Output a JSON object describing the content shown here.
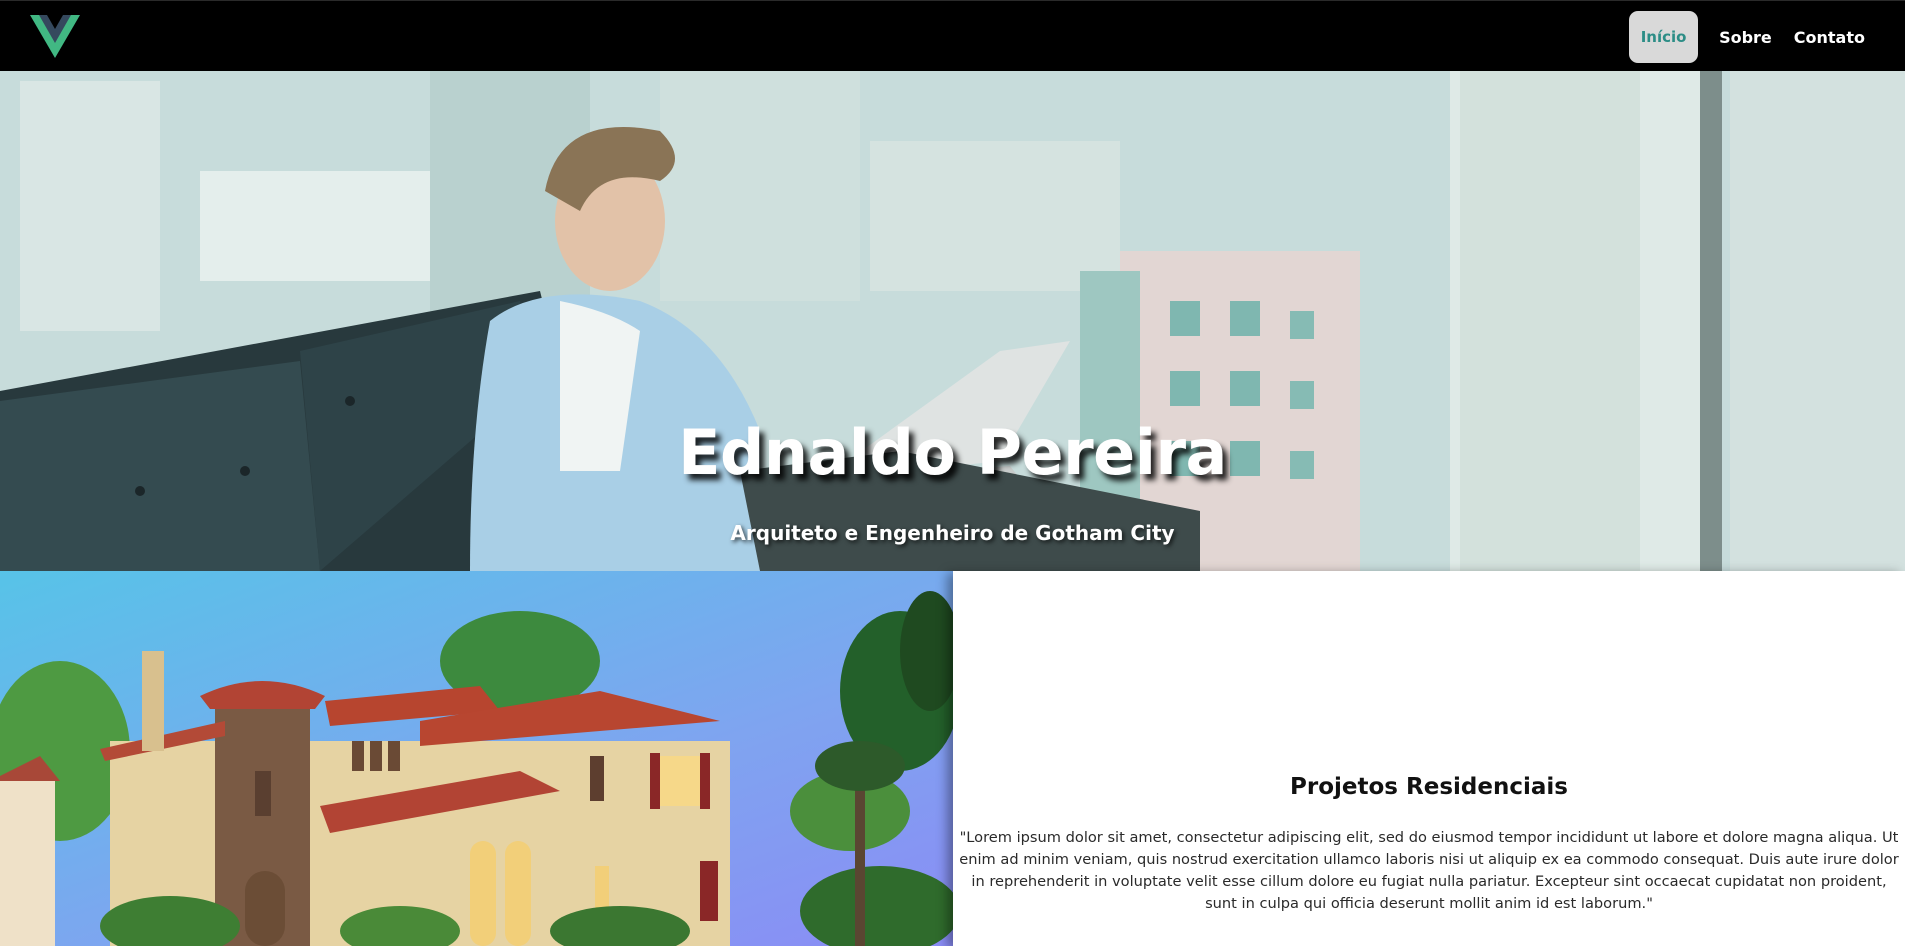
{
  "navbar": {
    "logo_name": "vue-logo",
    "links": [
      {
        "label": "Início",
        "active": true
      },
      {
        "label": "Sobre",
        "active": false
      },
      {
        "label": "Contato",
        "active": false
      }
    ],
    "active_color": "#2c8d86"
  },
  "hero": {
    "title": "Ednaldo Pereira",
    "subtitle": "Arquiteto e Engenheiro de Gotham City"
  },
  "project": {
    "title": "Projetos Residenciais",
    "text": "\"Lorem ipsum dolor sit amet, consectetur adipiscing elit, sed do eiusmod tempor incididunt ut labore et dolore magna aliqua. Ut enim ad minim veniam, quis nostrud exercitation ullamco laboris nisi ut aliquip ex ea commodo consequat. Duis aute irure dolor in reprehenderit in voluptate velit esse cillum dolore eu fugiat nulla pariatur. Excepteur sint occaecat cupidatat non proident, sunt in culpa qui officia deserunt mollit anim id est laborum.\""
  }
}
